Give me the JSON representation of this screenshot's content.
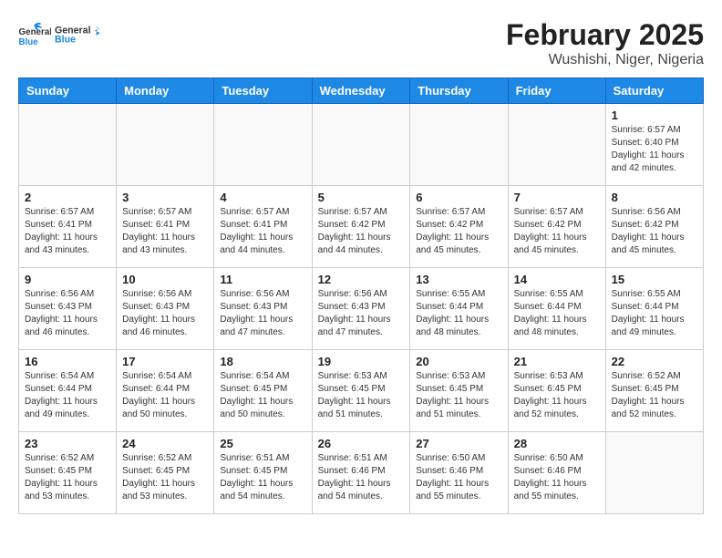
{
  "logo": {
    "general": "General",
    "blue": "Blue"
  },
  "header": {
    "month": "February 2025",
    "location": "Wushishi, Niger, Nigeria"
  },
  "days_of_week": [
    "Sunday",
    "Monday",
    "Tuesday",
    "Wednesday",
    "Thursday",
    "Friday",
    "Saturday"
  ],
  "weeks": [
    [
      {
        "day": "",
        "info": ""
      },
      {
        "day": "",
        "info": ""
      },
      {
        "day": "",
        "info": ""
      },
      {
        "day": "",
        "info": ""
      },
      {
        "day": "",
        "info": ""
      },
      {
        "day": "",
        "info": ""
      },
      {
        "day": "1",
        "info": "Sunrise: 6:57 AM\nSunset: 6:40 PM\nDaylight: 11 hours and 42 minutes."
      }
    ],
    [
      {
        "day": "2",
        "info": "Sunrise: 6:57 AM\nSunset: 6:41 PM\nDaylight: 11 hours and 43 minutes."
      },
      {
        "day": "3",
        "info": "Sunrise: 6:57 AM\nSunset: 6:41 PM\nDaylight: 11 hours and 43 minutes."
      },
      {
        "day": "4",
        "info": "Sunrise: 6:57 AM\nSunset: 6:41 PM\nDaylight: 11 hours and 44 minutes."
      },
      {
        "day": "5",
        "info": "Sunrise: 6:57 AM\nSunset: 6:42 PM\nDaylight: 11 hours and 44 minutes."
      },
      {
        "day": "6",
        "info": "Sunrise: 6:57 AM\nSunset: 6:42 PM\nDaylight: 11 hours and 45 minutes."
      },
      {
        "day": "7",
        "info": "Sunrise: 6:57 AM\nSunset: 6:42 PM\nDaylight: 11 hours and 45 minutes."
      },
      {
        "day": "8",
        "info": "Sunrise: 6:56 AM\nSunset: 6:42 PM\nDaylight: 11 hours and 45 minutes."
      }
    ],
    [
      {
        "day": "9",
        "info": "Sunrise: 6:56 AM\nSunset: 6:43 PM\nDaylight: 11 hours and 46 minutes."
      },
      {
        "day": "10",
        "info": "Sunrise: 6:56 AM\nSunset: 6:43 PM\nDaylight: 11 hours and 46 minutes."
      },
      {
        "day": "11",
        "info": "Sunrise: 6:56 AM\nSunset: 6:43 PM\nDaylight: 11 hours and 47 minutes."
      },
      {
        "day": "12",
        "info": "Sunrise: 6:56 AM\nSunset: 6:43 PM\nDaylight: 11 hours and 47 minutes."
      },
      {
        "day": "13",
        "info": "Sunrise: 6:55 AM\nSunset: 6:44 PM\nDaylight: 11 hours and 48 minutes."
      },
      {
        "day": "14",
        "info": "Sunrise: 6:55 AM\nSunset: 6:44 PM\nDaylight: 11 hours and 48 minutes."
      },
      {
        "day": "15",
        "info": "Sunrise: 6:55 AM\nSunset: 6:44 PM\nDaylight: 11 hours and 49 minutes."
      }
    ],
    [
      {
        "day": "16",
        "info": "Sunrise: 6:54 AM\nSunset: 6:44 PM\nDaylight: 11 hours and 49 minutes."
      },
      {
        "day": "17",
        "info": "Sunrise: 6:54 AM\nSunset: 6:44 PM\nDaylight: 11 hours and 50 minutes."
      },
      {
        "day": "18",
        "info": "Sunrise: 6:54 AM\nSunset: 6:45 PM\nDaylight: 11 hours and 50 minutes."
      },
      {
        "day": "19",
        "info": "Sunrise: 6:53 AM\nSunset: 6:45 PM\nDaylight: 11 hours and 51 minutes."
      },
      {
        "day": "20",
        "info": "Sunrise: 6:53 AM\nSunset: 6:45 PM\nDaylight: 11 hours and 51 minutes."
      },
      {
        "day": "21",
        "info": "Sunrise: 6:53 AM\nSunset: 6:45 PM\nDaylight: 11 hours and 52 minutes."
      },
      {
        "day": "22",
        "info": "Sunrise: 6:52 AM\nSunset: 6:45 PM\nDaylight: 11 hours and 52 minutes."
      }
    ],
    [
      {
        "day": "23",
        "info": "Sunrise: 6:52 AM\nSunset: 6:45 PM\nDaylight: 11 hours and 53 minutes."
      },
      {
        "day": "24",
        "info": "Sunrise: 6:52 AM\nSunset: 6:45 PM\nDaylight: 11 hours and 53 minutes."
      },
      {
        "day": "25",
        "info": "Sunrise: 6:51 AM\nSunset: 6:45 PM\nDaylight: 11 hours and 54 minutes."
      },
      {
        "day": "26",
        "info": "Sunrise: 6:51 AM\nSunset: 6:46 PM\nDaylight: 11 hours and 54 minutes."
      },
      {
        "day": "27",
        "info": "Sunrise: 6:50 AM\nSunset: 6:46 PM\nDaylight: 11 hours and 55 minutes."
      },
      {
        "day": "28",
        "info": "Sunrise: 6:50 AM\nSunset: 6:46 PM\nDaylight: 11 hours and 55 minutes."
      },
      {
        "day": "",
        "info": ""
      }
    ]
  ]
}
